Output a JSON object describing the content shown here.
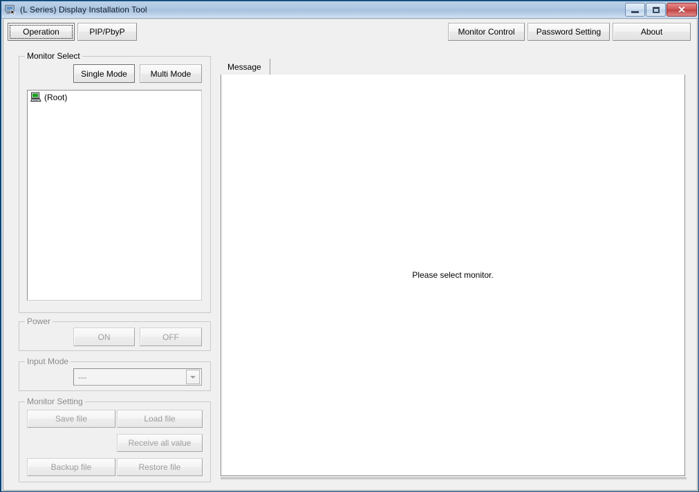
{
  "window": {
    "title": "(L Series) Display Installation Tool",
    "icon": "display-tool-icon",
    "controls": {
      "minimize_label": "–",
      "maximize_label": "□",
      "close_label": "✕"
    }
  },
  "toolbar": {
    "left_buttons": [
      {
        "label": "Operation",
        "focused": true
      },
      {
        "label": "PIP/PbyP",
        "focused": false
      }
    ],
    "right_buttons": [
      {
        "label": "Monitor Control"
      },
      {
        "label": "Password Setting"
      },
      {
        "label": "About"
      }
    ]
  },
  "monitor_select": {
    "group_title": "Monitor Select",
    "single_mode_label": "Single Mode",
    "multi_mode_label": "Multi Mode",
    "tree": {
      "nodes": [
        {
          "label": "(Root)",
          "icon": "computer-icon"
        }
      ]
    }
  },
  "power": {
    "group_title": "Power",
    "on_label": "ON",
    "off_label": "OFF",
    "enabled": false
  },
  "input_mode": {
    "group_title": "Input Mode",
    "selected_value": "---",
    "enabled": false
  },
  "monitor_setting": {
    "group_title": "Monitor Setting",
    "buttons": [
      {
        "label": "Save file"
      },
      {
        "label": "Load file"
      },
      {
        "label": "Receive all value"
      },
      {
        "label": "Backup file"
      },
      {
        "label": "Restore file"
      }
    ],
    "enabled": false
  },
  "right_panel": {
    "tabs": [
      {
        "label": "Message",
        "active": true
      }
    ],
    "message": "Please select monitor."
  },
  "colors": {
    "window_chrome": "#f0f0f0",
    "titlebar_blue": "#b0c8e2",
    "close_red": "#c24343",
    "disabled_text": "#9d9d9d",
    "tree_background": "#ffffff"
  }
}
